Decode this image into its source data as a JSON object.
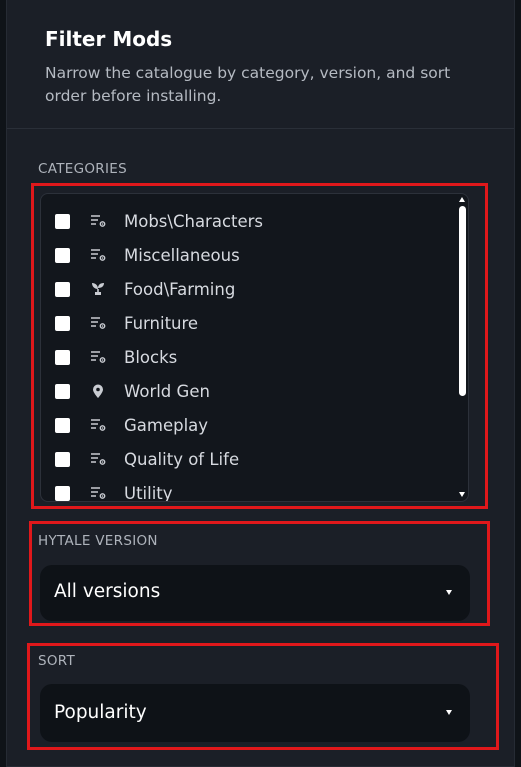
{
  "header": {
    "title": "Filter Mods",
    "subtitle": "Narrow the catalogue by category, version, and sort order before installing."
  },
  "categories": {
    "label": "CATEGORIES",
    "items": [
      {
        "label": "Mobs\\Characters",
        "icon": "list-settings-icon",
        "checked": false
      },
      {
        "label": "Miscellaneous",
        "icon": "list-settings-icon",
        "checked": false
      },
      {
        "label": "Food\\Farming",
        "icon": "sprout-icon",
        "checked": false
      },
      {
        "label": "Furniture",
        "icon": "list-settings-icon",
        "checked": false
      },
      {
        "label": "Blocks",
        "icon": "list-settings-icon",
        "checked": false
      },
      {
        "label": "World Gen",
        "icon": "map-pin-icon",
        "checked": false
      },
      {
        "label": "Gameplay",
        "icon": "list-settings-icon",
        "checked": false
      },
      {
        "label": "Quality of Life",
        "icon": "list-settings-icon",
        "checked": false
      },
      {
        "label": "Utility",
        "icon": "list-settings-icon",
        "checked": false
      }
    ]
  },
  "version": {
    "label": "HYTALE VERSION",
    "selected": "All versions"
  },
  "sort": {
    "label": "SORT",
    "selected": "Popularity"
  },
  "colors": {
    "panel_bg": "#1b1f27",
    "input_bg": "#0e1217",
    "highlight": "#e0181b"
  }
}
